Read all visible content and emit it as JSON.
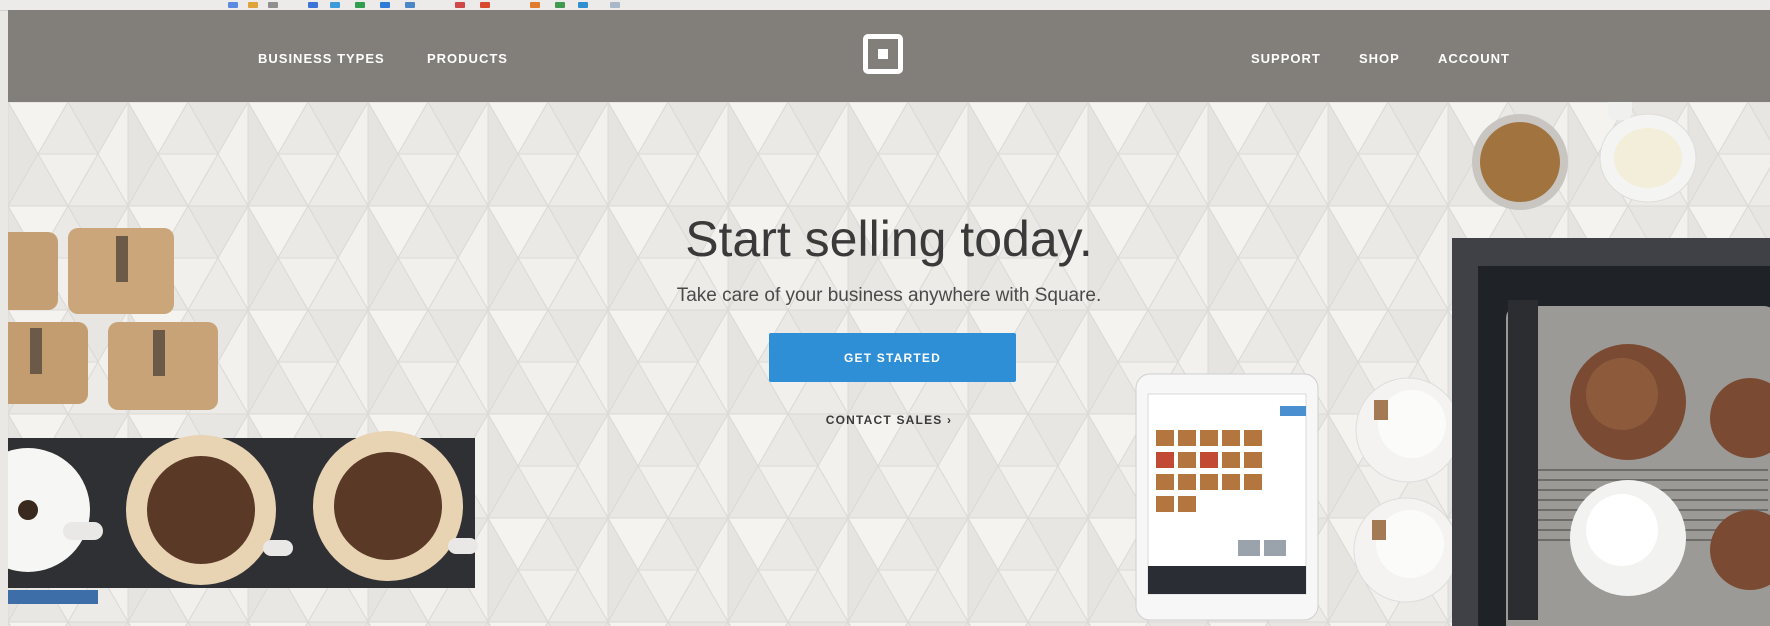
{
  "nav": {
    "left": [
      {
        "label": "BUSINESS TYPES"
      },
      {
        "label": "PRODUCTS"
      }
    ],
    "right": [
      {
        "label": "SUPPORT"
      },
      {
        "label": "SHOP"
      },
      {
        "label": "ACCOUNT"
      }
    ],
    "logo_icon": "square-logo-icon"
  },
  "hero": {
    "title": "Start selling today.",
    "subtitle": "Take care of your business anywhere with Square.",
    "cta_label": "GET STARTED",
    "contact_label": "CONTACT SALES ›"
  },
  "colors": {
    "nav_bg": "#827e7a",
    "cta_bg": "#2e8fd6",
    "background": "#efeeeb"
  }
}
